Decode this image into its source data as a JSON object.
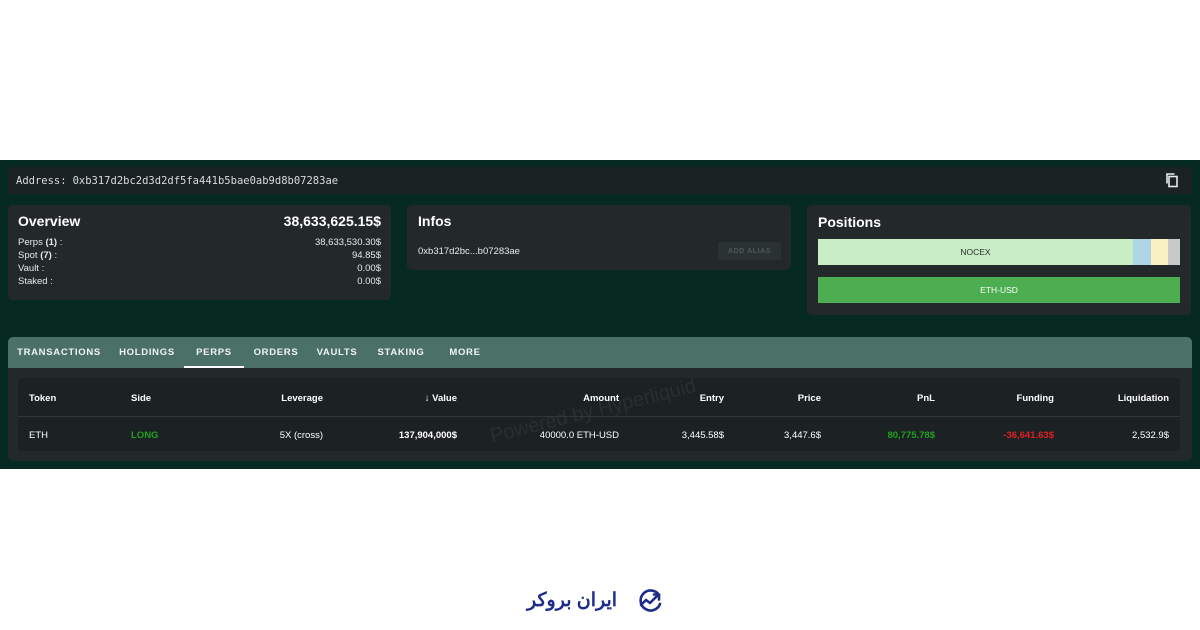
{
  "address_bar": {
    "label": "Address:",
    "address": "0xb317d2bc2d3d2df5fa441b5bae0ab9d8b07283ae"
  },
  "overview": {
    "title": "Overview",
    "total": "38,633,625.15$",
    "rows": [
      {
        "label_pre": "Perps ",
        "label_count": "(1)",
        "label_post": " :",
        "value": "38,633,530.30$"
      },
      {
        "label_pre": "Spot ",
        "label_count": "(7)",
        "label_post": " :",
        "value": "94.85$"
      },
      {
        "label_pre": "Vault",
        "label_count": "",
        "label_post": " :",
        "value": "0.00$"
      },
      {
        "label_pre": "Staked",
        "label_count": "",
        "label_post": " :",
        "value": "0.00$"
      }
    ]
  },
  "infos": {
    "title": "Infos",
    "short_address": "0xb317d2bc...b07283ae",
    "add_alias_label": "ADD ALIAS"
  },
  "positions": {
    "title": "Positions",
    "allocation_bar": {
      "segments": [
        {
          "label": "NOCEX",
          "color": "#c8ecc4"
        },
        {
          "label": "",
          "color": "#aed4e6"
        },
        {
          "label": "",
          "color": "#f7f2bf"
        },
        {
          "label": "",
          "color": "#c9c9c9"
        }
      ]
    },
    "eth_bar_label": "ETH-USD",
    "eth_bar_color": "#4cae50"
  },
  "tabs": [
    {
      "label": "TRANSACTIONS",
      "active": false
    },
    {
      "label": "HOLDINGS",
      "active": false
    },
    {
      "label": "PERPS",
      "active": true
    },
    {
      "label": "ORDERS",
      "active": false
    },
    {
      "label": "VAULTS",
      "active": false
    },
    {
      "label": "STAKING",
      "active": false
    },
    {
      "label": "MORE",
      "active": false
    }
  ],
  "table": {
    "columns": [
      "Token",
      "Side",
      "Leverage",
      "Value",
      "Amount",
      "Entry",
      "Price",
      "PnL",
      "Funding",
      "Liquidation"
    ],
    "sort_icon": "arrow-down-icon",
    "rows": [
      {
        "token": "ETH",
        "side": "LONG",
        "leverage": "5X (cross)",
        "value": "137,904,000$",
        "amount": "40000.0 ETH-USD",
        "entry": "3,445.58$",
        "price": "3,447.6$",
        "pnl": "80,775.78$",
        "funding": "-36,641.63$",
        "liquidation": "2,532.9$"
      }
    ],
    "watermark": "Powered by Hyperliquid"
  },
  "footer": {
    "logo_text": "ایران بروکر"
  },
  "colors": {
    "app_bg": "#062a22",
    "card_bg": "#23292b",
    "tab_bar": "#4a7068",
    "positive": "#1fa01f",
    "negative": "#e02020",
    "logo": "#1d2b8a"
  }
}
